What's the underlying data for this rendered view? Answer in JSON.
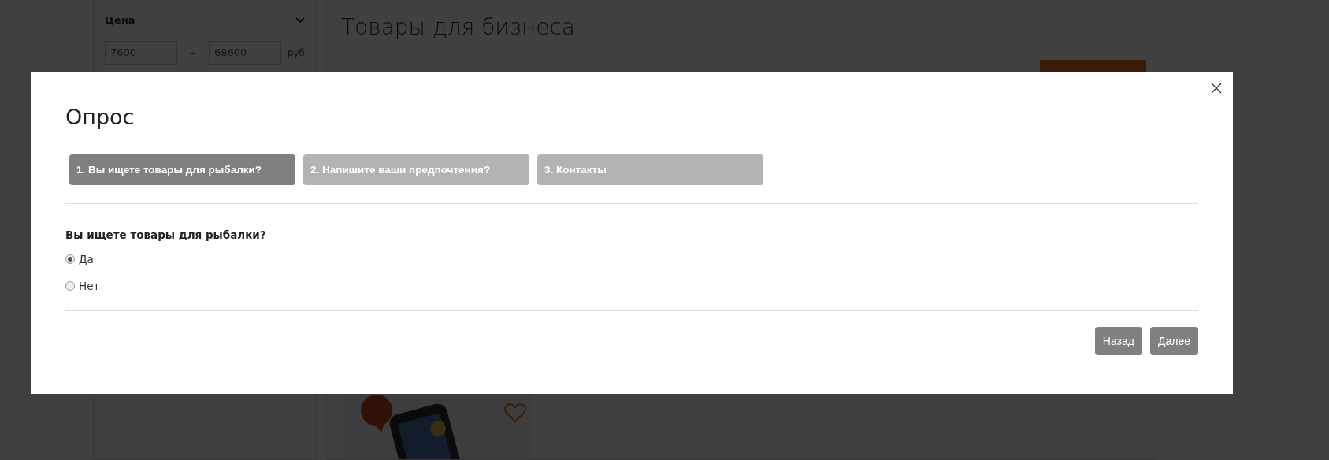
{
  "page": {
    "filter": {
      "title": "Цена",
      "price_from": "7600",
      "separator": "–",
      "price_to": "68600",
      "currency": "руб"
    },
    "heading": "Товары для бизнеса"
  },
  "modal": {
    "title": "Опрос",
    "steps": [
      {
        "label": "1. Вы ищете товары для рыбалки?",
        "selected": true
      },
      {
        "label": "2. Напишите ваши предпочтения?",
        "selected": false
      },
      {
        "label": "3. Контакты",
        "selected": false
      }
    ],
    "question": "Вы ищете товары для рыбалки?",
    "options": [
      {
        "label": "Да",
        "selected": true
      },
      {
        "label": "Нет",
        "selected": false
      }
    ],
    "buttons": [
      "Назад",
      "Далее"
    ]
  }
}
